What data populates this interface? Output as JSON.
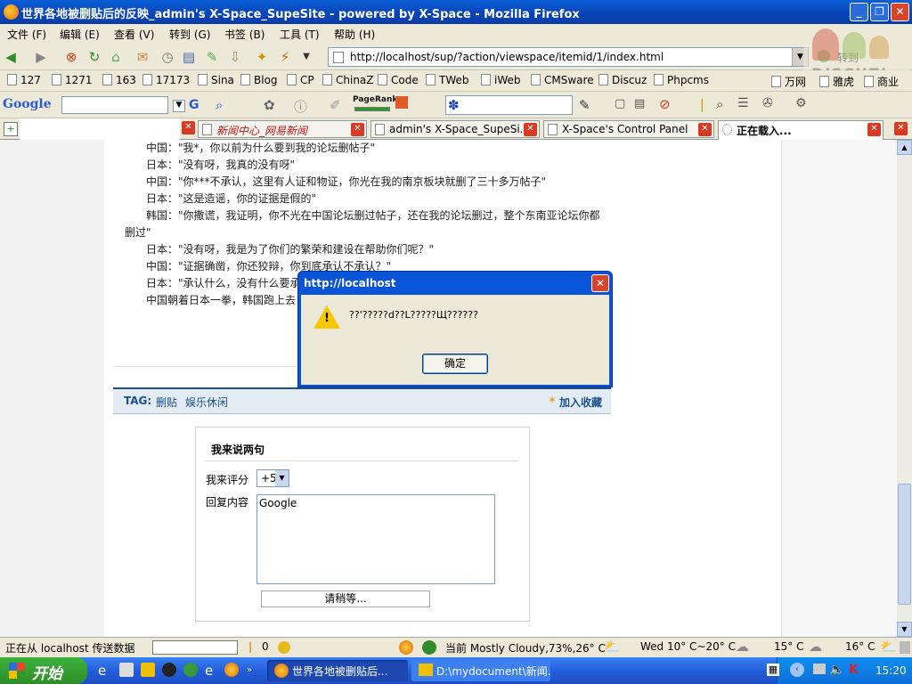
{
  "window": {
    "title": "世界各地被删贴后的反映_admin's X-Space_SupeSite - powered by X-Space - Mozilla Firefox",
    "min": "_",
    "max": "❐",
    "close": "✕"
  },
  "menu": [
    "文件 (F)",
    "编辑 (E)",
    "查看 (V)",
    "转到 (G)",
    "书签 (B)",
    "工具 (T)",
    "帮助 (H)"
  ],
  "nav": {
    "url": "http://localhost/sup/?action/viewspace/itemid/1/index.html",
    "go_label": "转到",
    "logo_text": "DISCUZ!"
  },
  "bookmarks": [
    "127",
    "1271",
    "163",
    "17173",
    "Sina",
    "Blog",
    "CP",
    "ChinaZ",
    "Code",
    "TWeb",
    "iWeb",
    "CMSware",
    "Discuz",
    "Phpcms",
    "万网",
    "雅虎",
    "商业"
  ],
  "google_bar": {
    "logo": "Google",
    "pagerank": "PageRank",
    "search_value": ""
  },
  "tabs": [
    {
      "label": "新闻中心_网易新闻"
    },
    {
      "label": "admin's X-Space_SupeSi..."
    },
    {
      "label": "X-Space's Control Panel"
    },
    {
      "label": "正在载入..."
    }
  ],
  "article": {
    "lines": [
      "中国：\"我*，你以前为什么要到我的论坛删帖子\"",
      "日本：\"没有呀，我真的没有呀\"",
      "中国：\"你***不承认，这里有人证和物证，你光在我的南京板块就删了三十多万帖子\"",
      "日本：\"这是造谣，你的证据是假的\"",
      "韩国：\"你撒谎，我证明，你不光在中国论坛删过帖子，还在我的论坛删过，整个东南亚论坛你都",
      "删过\"",
      "日本：\"没有呀，我是为了你们的繁荣和建设在帮助你们呢？\"",
      "中国：\"证据确凿，你还狡辩，你到底承认不承认？\"",
      "日本：\"承认什么，没有什么要承",
      "中国朝着日本一拳，韩国跑上去"
    ]
  },
  "tagbar": {
    "tag_label": "TAG:",
    "tags": [
      "删贴",
      "娱乐休闲"
    ],
    "add_fav": "加入收藏"
  },
  "comment": {
    "title": "我来说两句",
    "rating_label": "我来评分",
    "rating_value": "+5",
    "content_label": "回复内容",
    "content_value": "Google",
    "submit_label": "请稍等..."
  },
  "dialog": {
    "title": "http://localhost",
    "message": "??'?????d??L?????Щ??????",
    "ok_label": "确定"
  },
  "status": {
    "text": "正在从 localhost 传送数据",
    "count": "0",
    "weather": "当前 Mostly Cloudy,73%,26° C",
    "forecast1": "Wed 10° C~20° C",
    "forecast2": "15° C",
    "forecast3": "16° C"
  },
  "taskbar": {
    "start": "开始",
    "tasks": [
      "世界各地被删贴后...",
      "D:\\mydocument\\新闻..."
    ],
    "time": "15:20"
  }
}
